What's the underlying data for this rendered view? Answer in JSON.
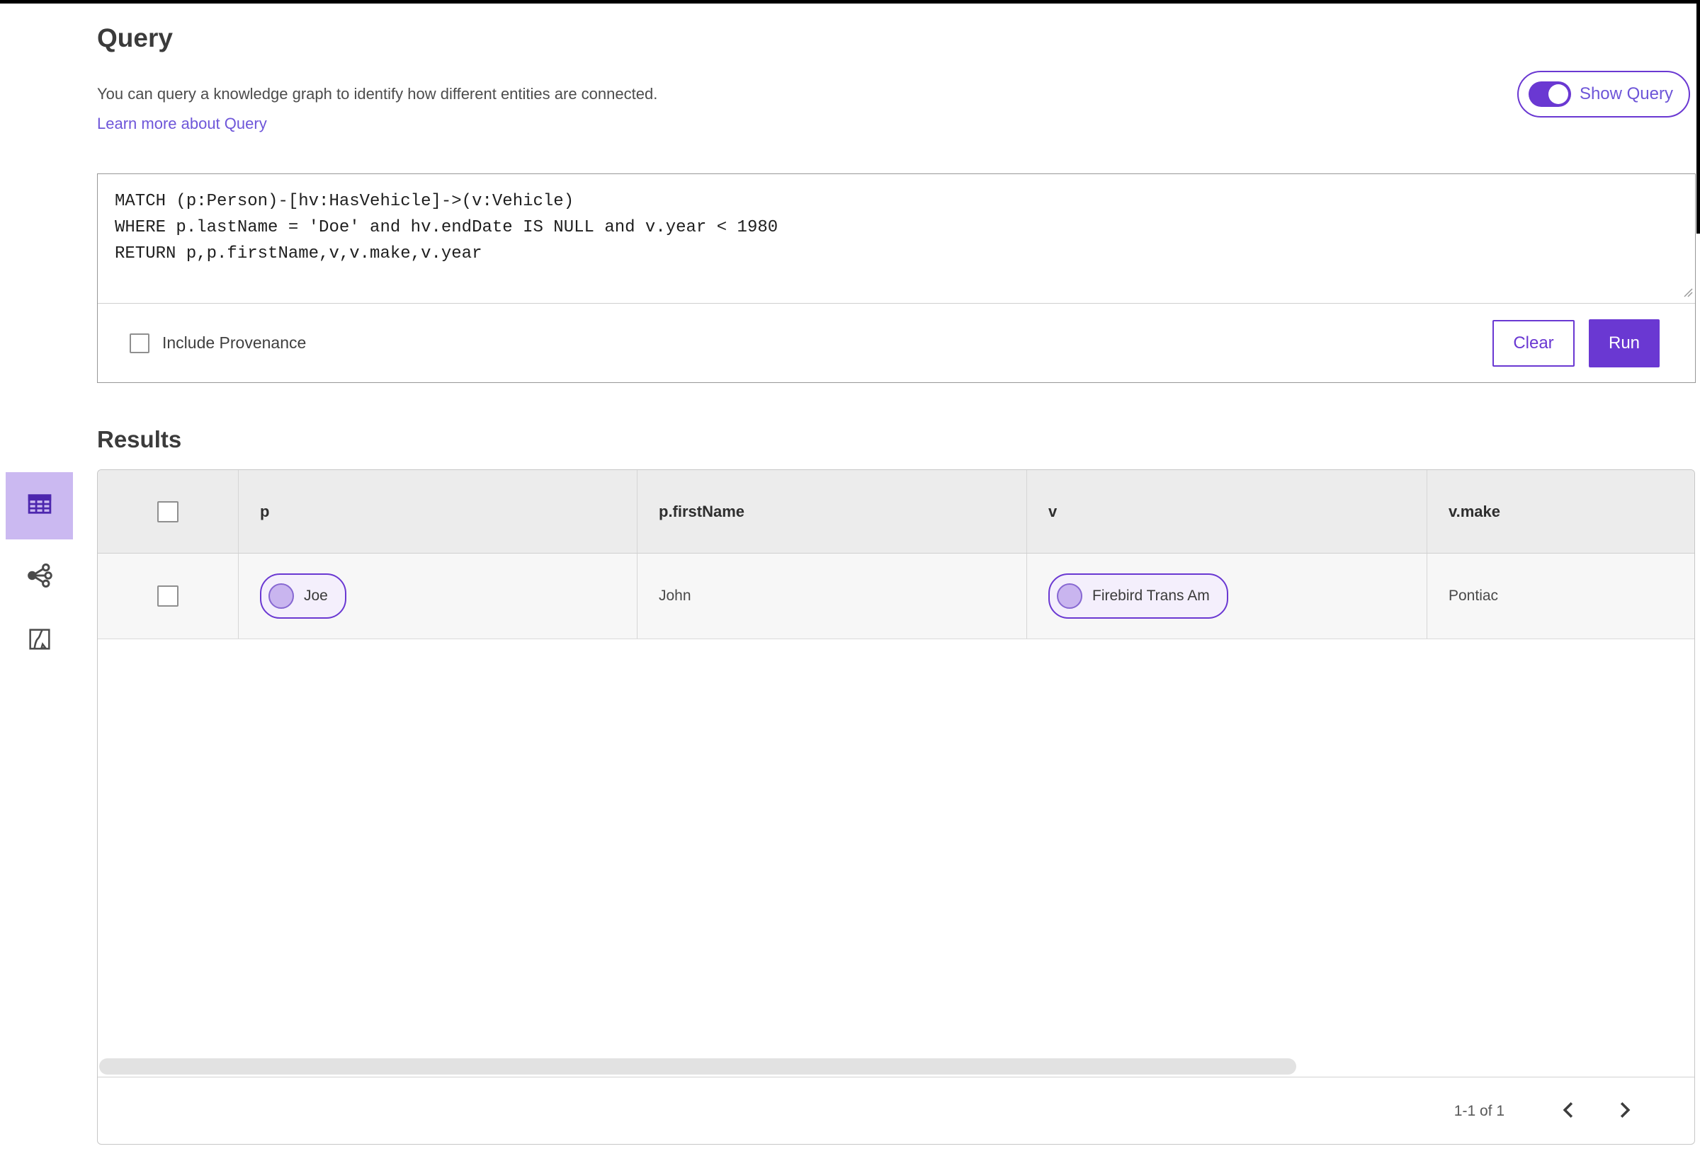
{
  "page": {
    "title": "Query",
    "description": "You can query a knowledge graph to identify how different entities are connected.",
    "learn_more_link": "Learn more about Query"
  },
  "show_query": {
    "label": "Show Query",
    "enabled": true
  },
  "query_editor": {
    "code": "MATCH (p:Person)-[hv:HasVehicle]->(v:Vehicle)\nWHERE p.lastName = 'Doe' and hv.endDate IS NULL and v.year < 1980\nRETURN p,p.firstName,v,v.make,v.year",
    "include_provenance": {
      "label": "Include Provenance",
      "checked": false
    },
    "clear_button": "Clear",
    "run_button": "Run"
  },
  "results": {
    "heading": "Results",
    "views": {
      "selected": "table",
      "options": [
        "table",
        "graph",
        "map"
      ]
    },
    "table": {
      "columns": [
        "p",
        "p.firstName",
        "v",
        "v.make"
      ],
      "rows": [
        {
          "p": "Joe",
          "p_firstName": "John",
          "v": "Firebird Trans Am",
          "v_make": "Pontiac"
        }
      ]
    },
    "pagination": {
      "range": "1-1 of 1"
    }
  },
  "colors": {
    "primary_purple": "#6a38d2",
    "selected_view_bg": "#cbb9f1",
    "chip_bg": "#f4effc",
    "header_bg": "#ececec",
    "row_bg": "#f7f7f7"
  }
}
